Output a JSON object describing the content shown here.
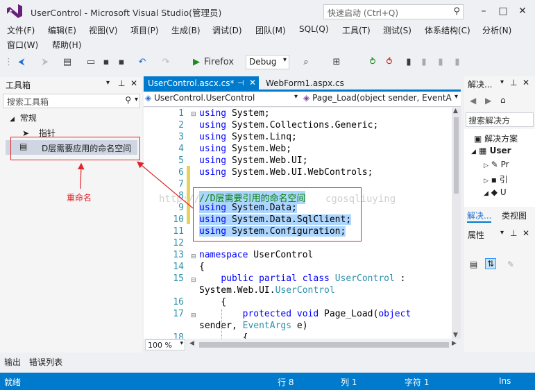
{
  "window": {
    "title": "UserControl - Microsoft Visual Studio(管理员)",
    "quick_launch_placeholder": "快速启动 (Ctrl+Q)"
  },
  "menu": {
    "row1": [
      "文件(F)",
      "编辑(E)",
      "视图(V)",
      "项目(P)",
      "生成(B)",
      "调试(D)",
      "团队(M)",
      "SQL(Q)",
      "工具(T)",
      "测试(S)",
      "体系结构(C)",
      "分析(N)"
    ],
    "row2": [
      "窗口(W)",
      "帮助(H)"
    ]
  },
  "toolbar": {
    "browser": "Firefox",
    "config": "Debug"
  },
  "toolbox": {
    "title": "工具箱",
    "search_placeholder": "搜索工具箱",
    "group": "常规",
    "items": [
      "指针",
      "D层需要应用的命名空间"
    ]
  },
  "annotation": {
    "label": "重命名"
  },
  "watermark": {
    "left": "http://",
    "right": "cgosqliuying"
  },
  "editor": {
    "tabs": [
      {
        "label": "UserControl.ascx.cs*",
        "active": true
      },
      {
        "label": "WebForm1.aspx.cs",
        "active": false
      }
    ],
    "nav_left": "UserControl.UserControl",
    "nav_right": "Page_Load(object sender, EventA",
    "zoom": "100 %",
    "line_numbers": [
      "1",
      "2",
      "3",
      "4",
      "5",
      "6",
      "7",
      "8",
      "9",
      "10",
      "11",
      "12",
      "13",
      "14",
      "15",
      "",
      "16",
      "17",
      "",
      "18"
    ],
    "lines": {
      "l1_kw": "using",
      "l1_rest": " System;",
      "l2_kw": "using",
      "l2_rest": " System.Collections.Generic;",
      "l3_kw": "using",
      "l3_rest": " System.Linq;",
      "l4_kw": "using",
      "l4_rest": " System.Web;",
      "l5_kw": "using",
      "l5_rest": " System.Web.UI;",
      "l6_kw": "using",
      "l6_rest": " System.Web.UI.WebControls;",
      "l8_comment": "//D层需要引用的命名空间",
      "l9_kw": "using",
      "l9_rest": " System.Data;",
      "l10_kw": "using",
      "l10_rest": " System.Data.SqlClient;",
      "l11_kw": "using",
      "l11_rest": " System.Configuration;",
      "l13_kw": "namespace",
      "l13_rest": " UserControl",
      "l14": "{",
      "l15_kw1": "public",
      "l15_kw2": "partial",
      "l15_kw3": "class",
      "l15_type": "UserControl",
      "l15_rest": " :",
      "l15b_a": "System.Web.UI.",
      "l15b_type": "UserControl",
      "l16": "{",
      "l17_kw1": "protected",
      "l17_kw2": "void",
      "l17_rest": " Page_Load(",
      "l17_kw3": "object",
      "l17b_a": "sender, ",
      "l17b_type": "EventArgs",
      "l17b_rest": " e)",
      "l18": "{"
    }
  },
  "solution_explorer": {
    "title": "解决...",
    "search": "搜索解决方",
    "items": [
      "解决方案",
      "User",
      "Pr",
      "引",
      "U"
    ],
    "tabs": [
      "解决...",
      "类视图"
    ]
  },
  "properties": {
    "title": "属性"
  },
  "bottom_tabs": [
    "输出",
    "错误列表"
  ],
  "status": {
    "ready": "就绪",
    "row": "行 8",
    "col": "列 1",
    "char": "字符 1",
    "mode": "Ins"
  }
}
